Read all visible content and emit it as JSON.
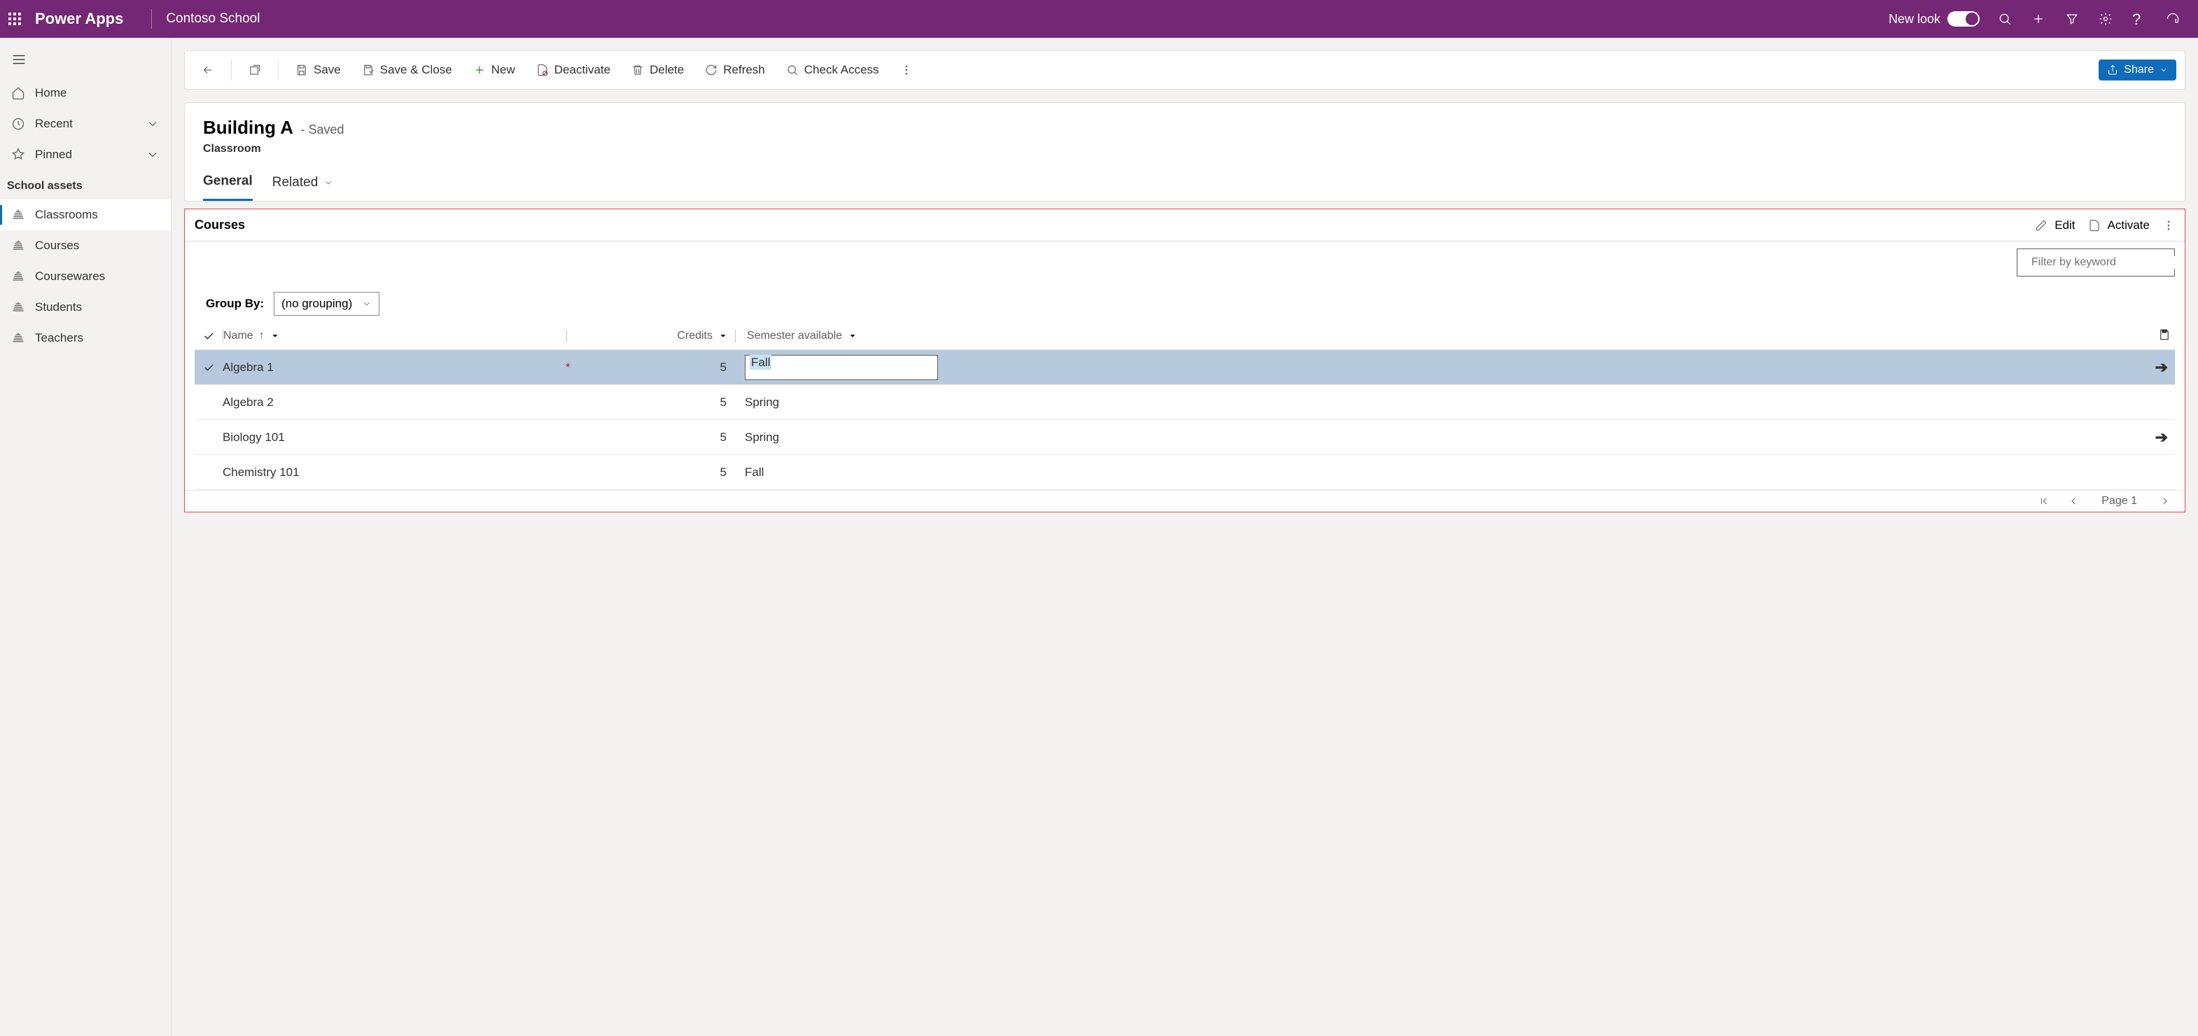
{
  "header": {
    "app_title": "Power Apps",
    "environment": "Contoso School",
    "new_look_label": "New look"
  },
  "sidebar": {
    "items": [
      {
        "label": "Home"
      },
      {
        "label": "Recent"
      },
      {
        "label": "Pinned"
      }
    ],
    "group_label": "School assets",
    "entities": [
      {
        "label": "Classrooms",
        "active": true
      },
      {
        "label": "Courses"
      },
      {
        "label": "Coursewares"
      },
      {
        "label": "Students"
      },
      {
        "label": "Teachers"
      }
    ]
  },
  "commandbar": {
    "save": "Save",
    "save_close": "Save & Close",
    "new": "New",
    "deactivate": "Deactivate",
    "delete": "Delete",
    "refresh": "Refresh",
    "check_access": "Check Access",
    "share": "Share"
  },
  "record": {
    "title": "Building A",
    "status": "- Saved",
    "entity": "Classroom",
    "tabs": {
      "general": "General",
      "related": "Related"
    }
  },
  "subgrid": {
    "title": "Courses",
    "edit": "Edit",
    "activate": "Activate",
    "filter_placeholder": "Filter by keyword",
    "groupby_label": "Group By:",
    "groupby_value": "(no grouping)",
    "columns": {
      "name": "Name",
      "credits": "Credits",
      "semester": "Semester available"
    },
    "rows": [
      {
        "name": "Algebra 1",
        "credits": "5",
        "semester": "Fall",
        "selected": true,
        "editing": true,
        "required": true,
        "arrow": true
      },
      {
        "name": "Algebra 2",
        "credits": "5",
        "semester": "Spring"
      },
      {
        "name": "Biology 101",
        "credits": "5",
        "semester": "Spring",
        "arrow": true
      },
      {
        "name": "Chemistry 101",
        "credits": "5",
        "semester": "Fall"
      }
    ],
    "pager": "Page 1"
  }
}
